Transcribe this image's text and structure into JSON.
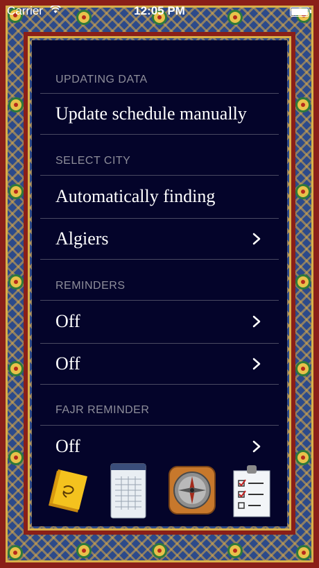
{
  "status_bar": {
    "carrier": "Carrier",
    "time": "12:05 PM"
  },
  "sections": {
    "updating": {
      "header": "UPDATING DATA",
      "row": "Update schedule manually"
    },
    "city": {
      "header": "SELECT CITY",
      "auto": "Automatically finding",
      "city": "Algiers"
    },
    "reminders": {
      "header": "REMINDERS",
      "first": "Off",
      "second": "Off"
    },
    "fajr": {
      "header": "FAJR REMINDER",
      "value": "Off"
    }
  },
  "toolbar": {
    "items": [
      "book-icon",
      "calendar-icon",
      "compass-icon",
      "checklist-icon"
    ]
  },
  "colors": {
    "panel": "#04042a",
    "frame_red": "#8a1f18",
    "frame_blue": "#2c4a8a",
    "frame_gold": "#d8b04a",
    "header_text": "#8e8e9a"
  }
}
